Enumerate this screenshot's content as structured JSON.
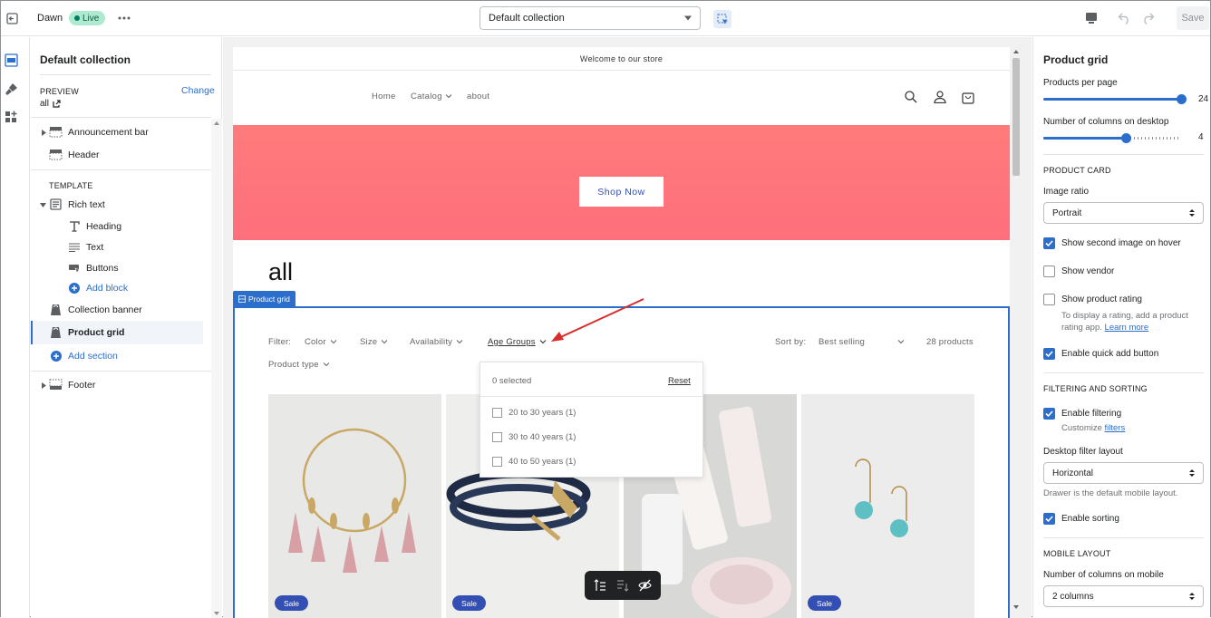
{
  "topbar": {
    "theme_name": "Dawn",
    "live_badge": "Live",
    "template_select": "Default collection",
    "save_label": "Save"
  },
  "sidebar": {
    "title": "Default collection",
    "preview_label": "PREVIEW",
    "change_label": "Change",
    "preview_value": "all",
    "sections": {
      "announcement_bar": "Announcement bar",
      "header": "Header",
      "template_label": "TEMPLATE",
      "rich_text": "Rich text",
      "heading": "Heading",
      "text": "Text",
      "buttons": "Buttons",
      "add_block": "Add block",
      "collection_banner": "Collection banner",
      "product_grid": "Product grid",
      "add_section": "Add section",
      "footer": "Footer"
    }
  },
  "preview": {
    "announcement": "Welcome to our store",
    "nav": {
      "home": "Home",
      "catalog": "Catalog",
      "about": "about"
    },
    "shop_now": "Shop Now",
    "collection_title": "all",
    "section_tag": "Product grid",
    "filter_label": "Filter:",
    "filters": {
      "color": "Color",
      "size": "Size",
      "availability": "Availability",
      "age_groups": "Age Groups",
      "product_type": "Product type"
    },
    "sort_label": "Sort by:",
    "sort_value": "Best selling",
    "product_count": "28 products",
    "dropdown": {
      "selected": "0 selected",
      "reset": "Reset",
      "options": [
        "20 to 30 years (1)",
        "30 to 40 years (1)",
        "40 to 50 years (1)"
      ]
    },
    "sale_badge": "Sale",
    "accent_color": "#2c6ecb",
    "banner_color": "#ff7b7b"
  },
  "settings": {
    "title": "Product grid",
    "products_per_page_label": "Products per page",
    "products_per_page_value": "24",
    "products_per_page_fraction": 1.0,
    "columns_desktop_label": "Number of columns on desktop",
    "columns_desktop_value": "4",
    "columns_desktop_fraction": 0.6,
    "product_card_heading": "PRODUCT CARD",
    "image_ratio_label": "Image ratio",
    "image_ratio_value": "Portrait",
    "show_second_image": "Show second image on hover",
    "show_vendor": "Show vendor",
    "show_rating": "Show product rating",
    "rating_help_1": "To display a rating, add a product",
    "rating_help_2": "rating app.",
    "rating_help_link": "Learn more",
    "quick_add": "Enable quick add button",
    "filtering_heading": "FILTERING AND SORTING",
    "enable_filtering": "Enable filtering",
    "customize_label": "Customize",
    "customize_link": "filters",
    "desktop_filter_label": "Desktop filter layout",
    "desktop_filter_value": "Horizontal",
    "drawer_help": "Drawer is the default mobile layout.",
    "enable_sorting": "Enable sorting",
    "mobile_heading": "MOBILE LAYOUT",
    "columns_mobile_label": "Number of columns on mobile",
    "columns_mobile_value": "2 columns"
  }
}
